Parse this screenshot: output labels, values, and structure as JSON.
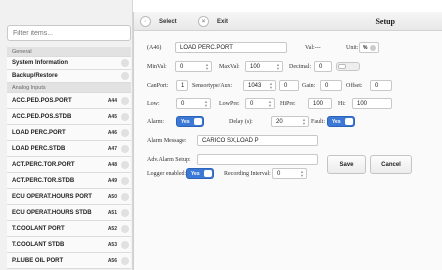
{
  "search": {
    "placeholder": "Filter items..."
  },
  "sidebar": {
    "rows": [
      {
        "type": "header",
        "label": "General"
      },
      {
        "type": "item",
        "label": "System Information"
      },
      {
        "type": "item",
        "label": "Backup/Restore"
      },
      {
        "type": "header",
        "label": "Analog Inputs"
      },
      {
        "type": "item",
        "label": "ACC.PED.POS.PORT",
        "tag": "A44"
      },
      {
        "type": "item",
        "label": "ACC.PED.POS.STDB",
        "tag": "A45"
      },
      {
        "type": "item",
        "label": "LOAD PERC.PORT",
        "tag": "A46"
      },
      {
        "type": "item",
        "label": "LOAD PERC.STDB",
        "tag": "A47"
      },
      {
        "type": "item",
        "label": "ACT.PERC.TOR.PORT",
        "tag": "A48"
      },
      {
        "type": "item",
        "label": "ACT.PERC.TOR.STDB",
        "tag": "A49"
      },
      {
        "type": "item",
        "label": "ECU OPERAT.HOURS PORT",
        "tag": "A50"
      },
      {
        "type": "item",
        "label": "ECU OPERAT.HOURS STDB",
        "tag": "A51"
      },
      {
        "type": "item",
        "label": "T.COOLANT PORT",
        "tag": "A52"
      },
      {
        "type": "item",
        "label": "T.COOLANT STDB",
        "tag": "A53"
      },
      {
        "type": "item",
        "label": "P.LUBE OIL PORT",
        "tag": "A56"
      }
    ]
  },
  "toolbar": {
    "select_label": "Select",
    "exit_label": "Exit",
    "title": "Setup"
  },
  "form": {
    "id": "(A46)",
    "name": "LOAD PERC.PORT",
    "val_label": "Val:---",
    "unit_label": "Unit:",
    "unit_value": "%",
    "minval_label": "MinVal:",
    "minval": "0",
    "maxval_label": "MaxVal:",
    "maxval": "100",
    "decimal_label": "Decimal:",
    "decimal": "0",
    "canport_label": "CanPort:",
    "canport": "1",
    "sensortype_label": "Sensortype/Aux:",
    "sensortype": "1043",
    "aux": "0",
    "gain_label": "Gain:",
    "gain": "0",
    "offset_label": "Offset:",
    "offset": "0",
    "low_label": "Low:",
    "low": "0",
    "lowpre_label": "LowPre:",
    "lowpre": "0",
    "hipre_label": "HiPre:",
    "hipre": "100",
    "hi_label": "Hi:",
    "hi": "100",
    "alarm_label": "Alarm:",
    "alarm_toggle": "Yes",
    "delay_label": "Delay (s):",
    "delay": "20",
    "fault_label": "Fault:",
    "fault_toggle": "Yes",
    "alarm_message_label": "Alarm Message:",
    "alarm_message": "CARICO SX,LOAD P",
    "adv_alarm_label": "Adv.Alarm Setup:",
    "adv_alarm": "",
    "logger_label": "Logger enabled:",
    "logger_toggle": "Yes",
    "rec_interval_label": "Recording Interval:",
    "rec_interval": "0",
    "save_label": "Save",
    "cancel_label": "Cancel"
  }
}
